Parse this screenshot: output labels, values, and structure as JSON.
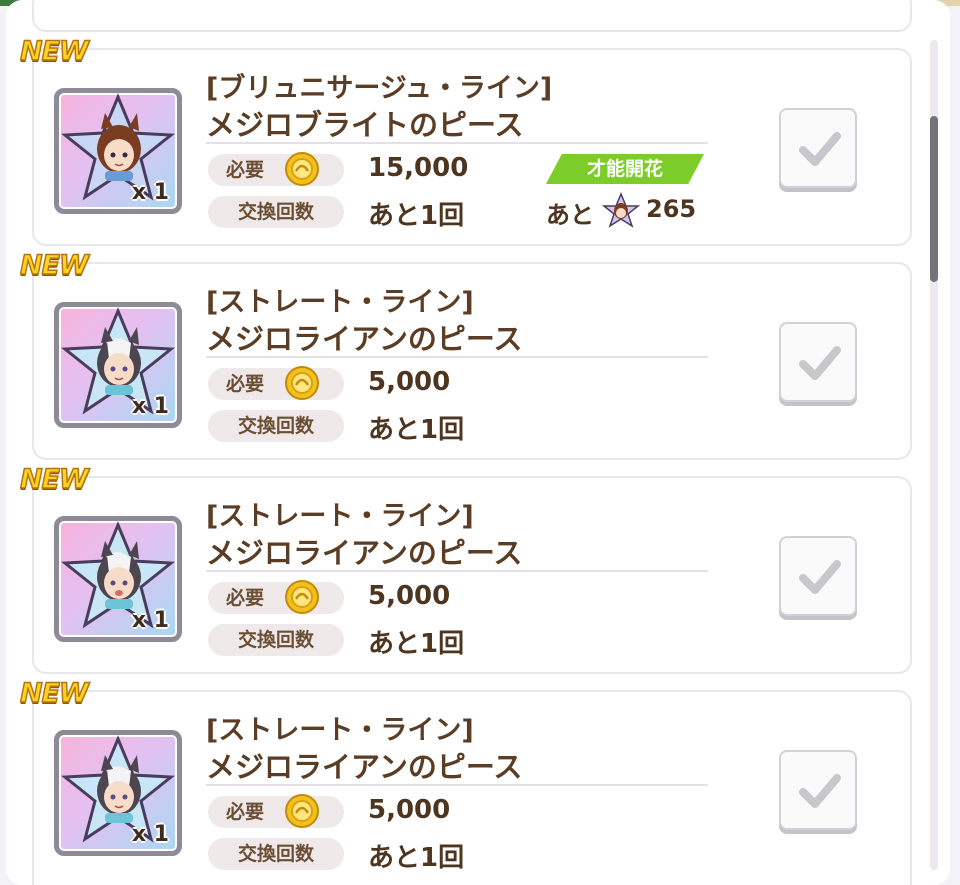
{
  "list": {
    "items": [
      {
        "badge": "NEW",
        "line_name": "[ブリュニサージュ・ライン]",
        "item_name": "メジロブライトのピース",
        "quantity": "x 1",
        "required_label": "必要",
        "cost": "15,000",
        "exchange_label": "交換回数",
        "exchange_remaining": "あと1回",
        "talent_tag": "才能開花",
        "talent_prefix": "あと",
        "talent_amount": "265",
        "checked": false
      },
      {
        "badge": "NEW",
        "line_name": "[ストレート・ライン]",
        "item_name": "メジロライアンのピース",
        "quantity": "x 1",
        "required_label": "必要",
        "cost": "5,000",
        "exchange_label": "交換回数",
        "exchange_remaining": "あと1回",
        "checked": false
      },
      {
        "badge": "NEW",
        "line_name": "[ストレート・ライン]",
        "item_name": "メジロライアンのピース",
        "quantity": "x 1",
        "required_label": "必要",
        "cost": "5,000",
        "exchange_label": "交換回数",
        "exchange_remaining": "あと1回",
        "checked": false
      },
      {
        "badge": "NEW",
        "line_name": "[ストレート・ライン]",
        "item_name": "メジロライアンのピース",
        "quantity": "x 1",
        "required_label": "必要",
        "cost": "5,000",
        "exchange_label": "交換回数",
        "exchange_remaining": "あと1回",
        "checked": false
      }
    ]
  },
  "colors": {
    "text_brown": "#5a3d24",
    "talent_green": "#7ccc2a",
    "badge_yellow": "#ffd21f",
    "coin_gold": "#f2c21b"
  }
}
